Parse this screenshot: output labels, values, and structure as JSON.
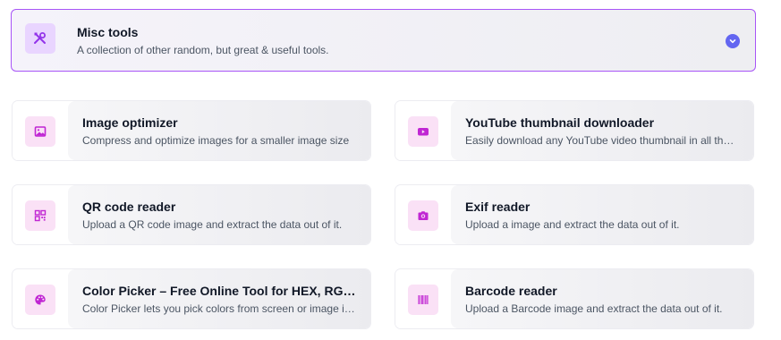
{
  "category": {
    "title": "Misc tools",
    "description": "A collection of other random, but great & useful tools.",
    "icon": "tools-icon",
    "expanded": true
  },
  "tools": [
    {
      "title": "Image optimizer",
      "description": "Compress and optimize images for a smaller image size",
      "icon": "image-icon"
    },
    {
      "title": "YouTube thumbnail downloader",
      "description": "Easily download any YouTube video thumbnail in all the sizes",
      "icon": "youtube-icon"
    },
    {
      "title": "QR code reader",
      "description": "Upload a QR code image and extract the data out of it.",
      "icon": "qr-code-icon"
    },
    {
      "title": "Exif reader",
      "description": "Upload a image and extract the data out of it.",
      "icon": "camera-icon"
    },
    {
      "title": "Color Picker – Free Online Tool for HEX, RGB & HSL",
      "description": "Color Picker lets you pick colors from screen or image instantly",
      "icon": "palette-icon"
    },
    {
      "title": "Barcode reader",
      "description": "Upload a Barcode image and extract the data out of it.",
      "icon": "barcode-icon"
    }
  ],
  "colors": {
    "accent": "#a855f7",
    "chevron": "#6366f1",
    "icon": "#c026d3",
    "category_icon": "#9333ea"
  }
}
